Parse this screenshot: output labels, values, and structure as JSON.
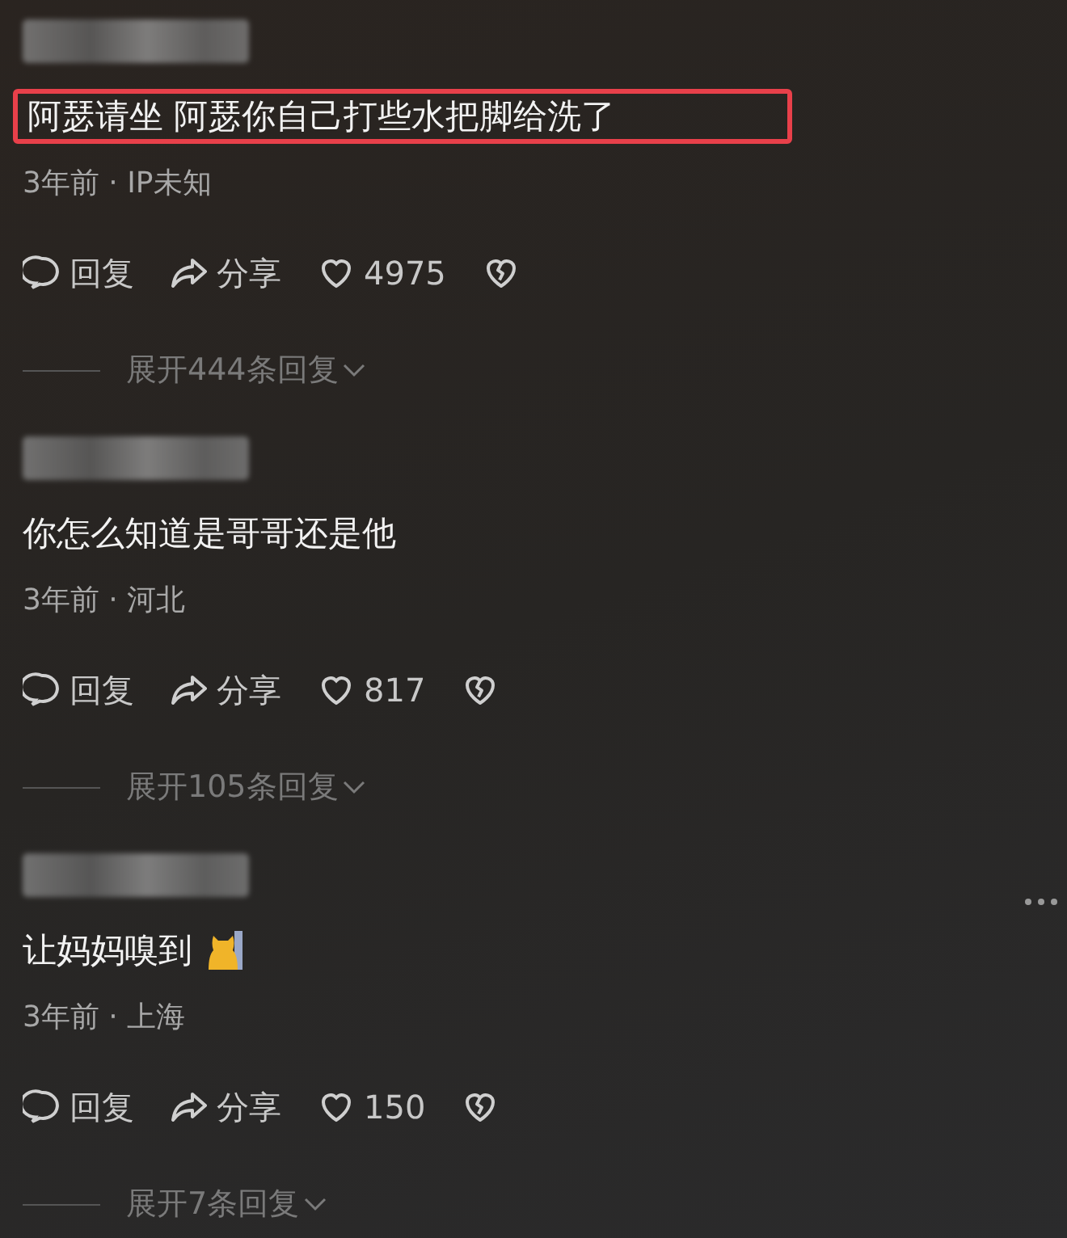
{
  "comments": [
    {
      "text": "阿瑟请坐 阿瑟你自己打些水把脚给洗了",
      "highlighted": true,
      "emoji": false,
      "meta": "3年前 · IP未知",
      "reply": "回复",
      "share": "分享",
      "likes": "4975",
      "expand": "展开444条回复",
      "more_menu": false
    },
    {
      "text": "你怎么知道是哥哥还是他",
      "highlighted": false,
      "emoji": false,
      "meta": "3年前 · 河北",
      "reply": "回复",
      "share": "分享",
      "likes": "817",
      "expand": "展开105条回复",
      "more_menu": false
    },
    {
      "text": "让妈妈嗅到",
      "highlighted": false,
      "emoji": true,
      "meta": "3年前 · 上海",
      "reply": "回复",
      "share": "分享",
      "likes": "150",
      "expand": "展开7条回复",
      "more_menu": true
    }
  ]
}
